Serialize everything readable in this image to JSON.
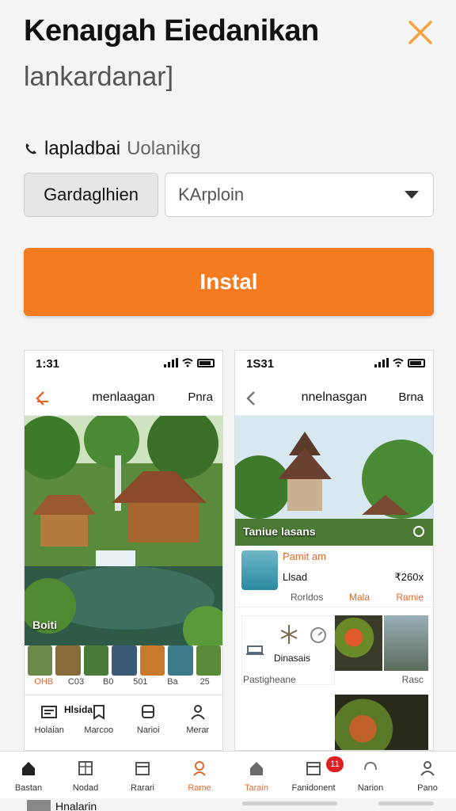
{
  "header": {
    "title": "Kenaıgah Eiedanikan",
    "subtitle": "lankardanar]",
    "close_icon": "close-x-icon",
    "accent": "#f47b20"
  },
  "meta": {
    "icon": "phone-icon",
    "label_bold": "lapladbai",
    "label_gray": "Uolanikg"
  },
  "controls": {
    "tag_button": "Gardaglhien",
    "select_value": "KArploin"
  },
  "install_button": "Instal",
  "phone_left": {
    "time": "1:31",
    "nav_title": "menlaagan",
    "nav_action": "Pnra",
    "hero_label": "Boiti",
    "thumb_captions": [
      "OHB",
      "C03",
      "B0",
      "501",
      "Ba",
      "25"
    ],
    "tabs": [
      "Hlsida",
      "Marcoo",
      "Narioi",
      "Merar"
    ],
    "tab_head": "Holaian"
  },
  "phone_right": {
    "time": "1S31",
    "nav_title": "nnelnasgan",
    "nav_action": "Brna",
    "hero_label": "Taniue lasans",
    "card": {
      "line1": "Pamit am",
      "line2": "Llsad",
      "price": "₹260x",
      "meta_left": "Rorldos",
      "meta_mid": "Mala",
      "meta_right": "Ramie"
    },
    "grid_label": "Dinasais",
    "caption_left": "Pastigheane",
    "caption_right": "Rasc"
  },
  "bottom_nav": {
    "items": [
      "Bastan",
      "Nodad",
      "Rarari",
      "Rame",
      "Tarain",
      "Fanidonent",
      "Narion",
      "Pano"
    ],
    "badge": "11",
    "active_index": 3
  },
  "peek": {
    "text": "Hnalarin"
  }
}
